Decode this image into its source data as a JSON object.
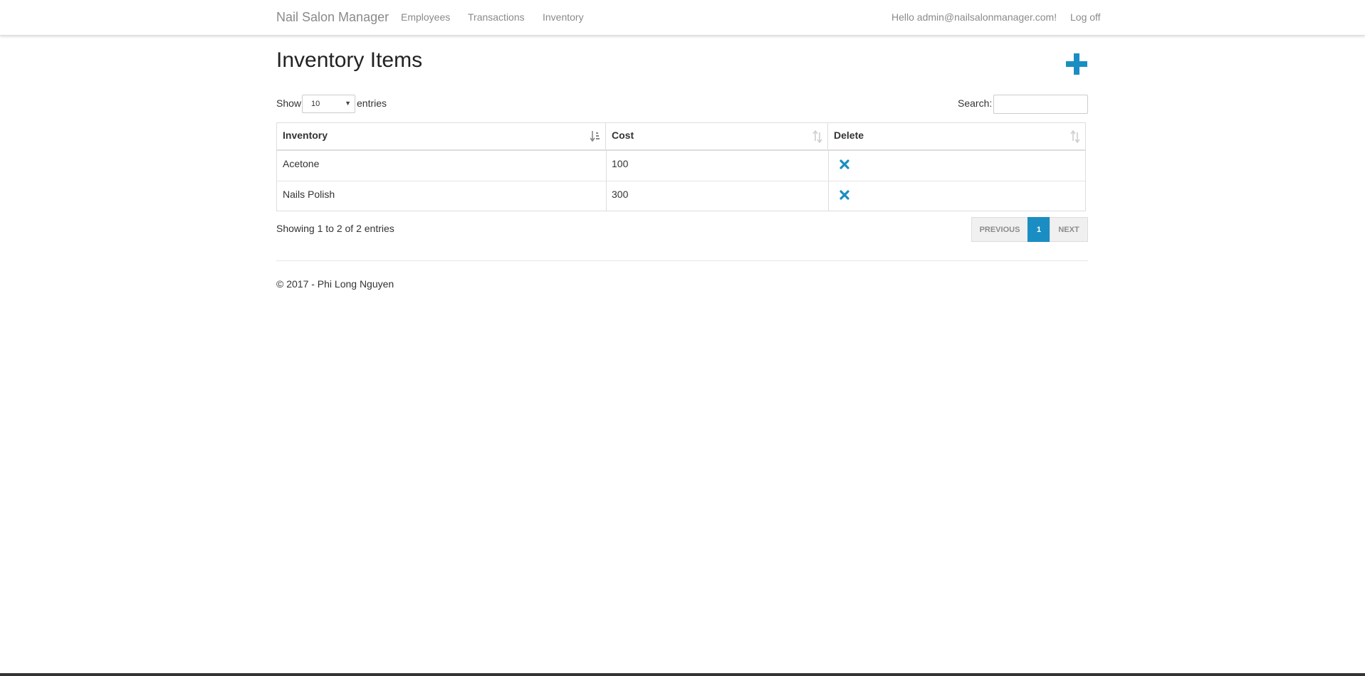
{
  "navbar": {
    "brand": "Nail Salon Manager",
    "links": [
      "Employees",
      "Transactions",
      "Inventory"
    ],
    "greeting": "Hello admin@nailsalonmanager.com!",
    "logoff": "Log off"
  },
  "page": {
    "title": "Inventory Items",
    "add_icon": "plus-icon"
  },
  "controls": {
    "show_label": "Show",
    "entries_label": "entries",
    "page_length": "10",
    "search_label": "Search:",
    "search_value": ""
  },
  "table": {
    "columns": [
      "Inventory",
      "Cost",
      "Delete"
    ],
    "rows": [
      {
        "inventory": "Acetone",
        "cost": "100",
        "delete_icon": "delete-x-icon"
      },
      {
        "inventory": "Nails Polish",
        "cost": "300",
        "delete_icon": "delete-x-icon"
      }
    ],
    "sorted_column": "Inventory"
  },
  "footer_info": {
    "showing": "Showing 1 to 2 of 2 entries"
  },
  "pagination": {
    "previous": "PREVIOUS",
    "current": "1",
    "next": "NEXT"
  },
  "footer": {
    "copyright": "© 2017 - Phi Long Nguyen"
  },
  "colors": {
    "accent": "#1a8ec2",
    "nav_text": "#8a8a8a"
  }
}
